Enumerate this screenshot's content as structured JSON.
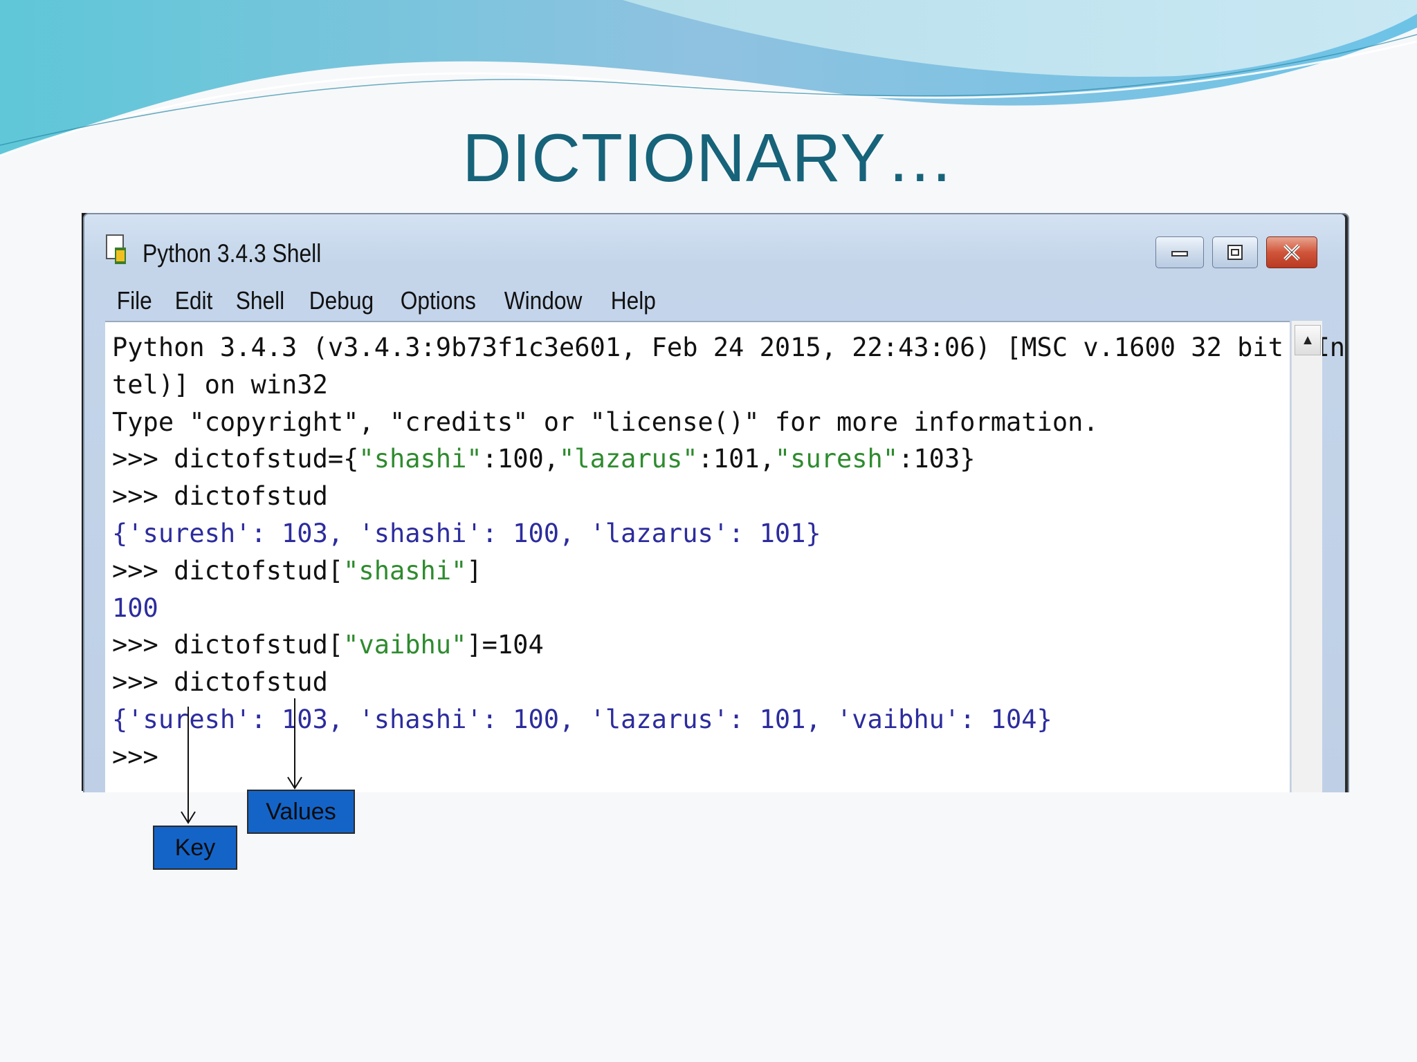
{
  "slide": {
    "title": "DICTIONARY…"
  },
  "window": {
    "title": "Python 3.4.3 Shell",
    "menu": [
      "File",
      "Edit",
      "Shell",
      "Debug",
      "Options",
      "Window",
      "Help"
    ]
  },
  "shell": {
    "lines": [
      [
        {
          "t": "Python 3.4.3 (v3.4.3:9b73f1c3e601, Feb 24 2015, 22:43:06) [MSC v.1600 32 bit (In",
          "c": ""
        }
      ],
      [
        {
          "t": "tel)] on win32",
          "c": ""
        }
      ],
      [
        {
          "t": "Type \"copyright\", \"credits\" or \"license()\" for more information.",
          "c": ""
        }
      ],
      [
        {
          "t": ">>> dictofstud={",
          "c": ""
        },
        {
          "t": "\"shashi\"",
          "c": "s"
        },
        {
          "t": ":100,",
          "c": ""
        },
        {
          "t": "\"lazarus\"",
          "c": "s"
        },
        {
          "t": ":101,",
          "c": ""
        },
        {
          "t": "\"suresh\"",
          "c": "s"
        },
        {
          "t": ":103}",
          "c": ""
        }
      ],
      [
        {
          "t": ">>> dictofstud",
          "c": ""
        }
      ],
      [
        {
          "t": "{'suresh': 103, 'shashi': 100, 'lazarus': 101}",
          "c": "o"
        }
      ],
      [
        {
          "t": ">>> dictofstud[",
          "c": ""
        },
        {
          "t": "\"shashi\"",
          "c": "s"
        },
        {
          "t": "]",
          "c": ""
        }
      ],
      [
        {
          "t": "100",
          "c": "o"
        }
      ],
      [
        {
          "t": ">>> dictofstud[",
          "c": ""
        },
        {
          "t": "\"vaibhu\"",
          "c": "s"
        },
        {
          "t": "]=104",
          "c": ""
        }
      ],
      [
        {
          "t": ">>> dictofstud",
          "c": ""
        }
      ],
      [
        {
          "t": "{'suresh': 103, 'shashi': 100, 'lazarus': 101, 'vaibhu': 104}",
          "c": "o"
        }
      ],
      [
        {
          "t": ">>> ",
          "c": ""
        }
      ]
    ]
  },
  "callouts": {
    "key": "Key",
    "values": "Values"
  },
  "colors": {
    "title": "#16637a",
    "string": "#2e8b2e",
    "output": "#2c2c9e",
    "callout": "#1464c8"
  }
}
